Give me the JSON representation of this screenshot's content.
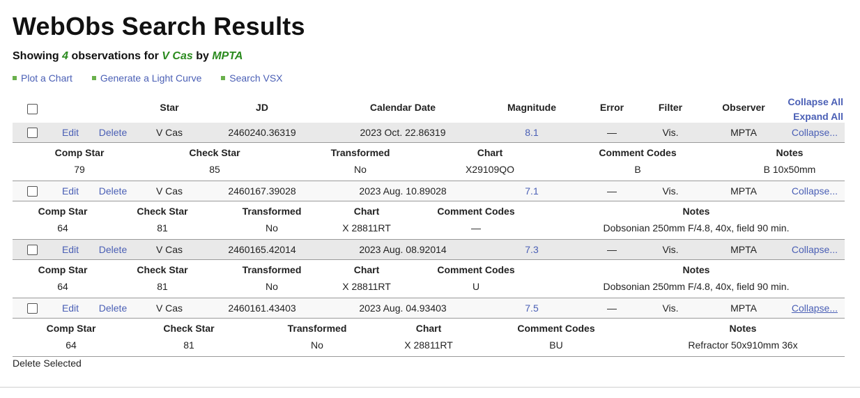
{
  "title": "WebObs Search Results",
  "summary": {
    "prefix": "Showing",
    "count": "4",
    "mid1": "observations for",
    "star": "V Cas",
    "mid2": "by",
    "observer": "MPTA"
  },
  "links": [
    "Plot a Chart",
    "Generate a Light Curve",
    "Search VSX"
  ],
  "columns": {
    "star": "Star",
    "jd": "JD",
    "date": "Calendar Date",
    "magnitude": "Magnitude",
    "error": "Error",
    "filter": "Filter",
    "observer": "Observer"
  },
  "controls": {
    "collapse_all": "Collapse All",
    "expand_all": "Expand All"
  },
  "row_actions": {
    "edit": "Edit",
    "delete": "Delete",
    "collapse": "Collapse..."
  },
  "detail_headers": {
    "comp": "Comp Star",
    "check": "Check Star",
    "transformed": "Transformed",
    "chart": "Chart",
    "codes": "Comment Codes",
    "notes": "Notes"
  },
  "observations": [
    {
      "star": "V Cas",
      "jd": "2460240.36319",
      "date": "2023 Oct. 22.86319",
      "magnitude": "8.1",
      "error": "—",
      "filter": "Vis.",
      "observer": "MPTA",
      "details": {
        "comp": "79",
        "check": "85",
        "transformed": "No",
        "chart": "X29109QO",
        "codes": "B",
        "notes": "B 10x50mm"
      }
    },
    {
      "star": "V Cas",
      "jd": "2460167.39028",
      "date": "2023 Aug. 10.89028",
      "magnitude": "7.1",
      "error": "—",
      "filter": "Vis.",
      "observer": "MPTA",
      "details": {
        "comp": "64",
        "check": "81",
        "transformed": "No",
        "chart": "X 28811RT",
        "codes": "—",
        "notes": "Dobsonian 250mm F/4.8, 40x, field 90 min."
      }
    },
    {
      "star": "V Cas",
      "jd": "2460165.42014",
      "date": "2023 Aug. 08.92014",
      "magnitude": "7.3",
      "error": "—",
      "filter": "Vis.",
      "observer": "MPTA",
      "details": {
        "comp": "64",
        "check": "81",
        "transformed": "No",
        "chart": "X 28811RT",
        "codes": "U",
        "notes": "Dobsonian 250mm F/4.8, 40x, field 90 min."
      }
    },
    {
      "star": "V Cas",
      "jd": "2460161.43403",
      "date": "2023 Aug. 04.93403",
      "magnitude": "7.5",
      "error": "—",
      "filter": "Vis.",
      "observer": "MPTA",
      "details": {
        "comp": "64",
        "check": "81",
        "transformed": "No",
        "chart": "X 28811RT",
        "codes": "BU",
        "notes": "Refractor 50x910mm 36x"
      }
    }
  ],
  "delete_selected": "Delete Selected"
}
